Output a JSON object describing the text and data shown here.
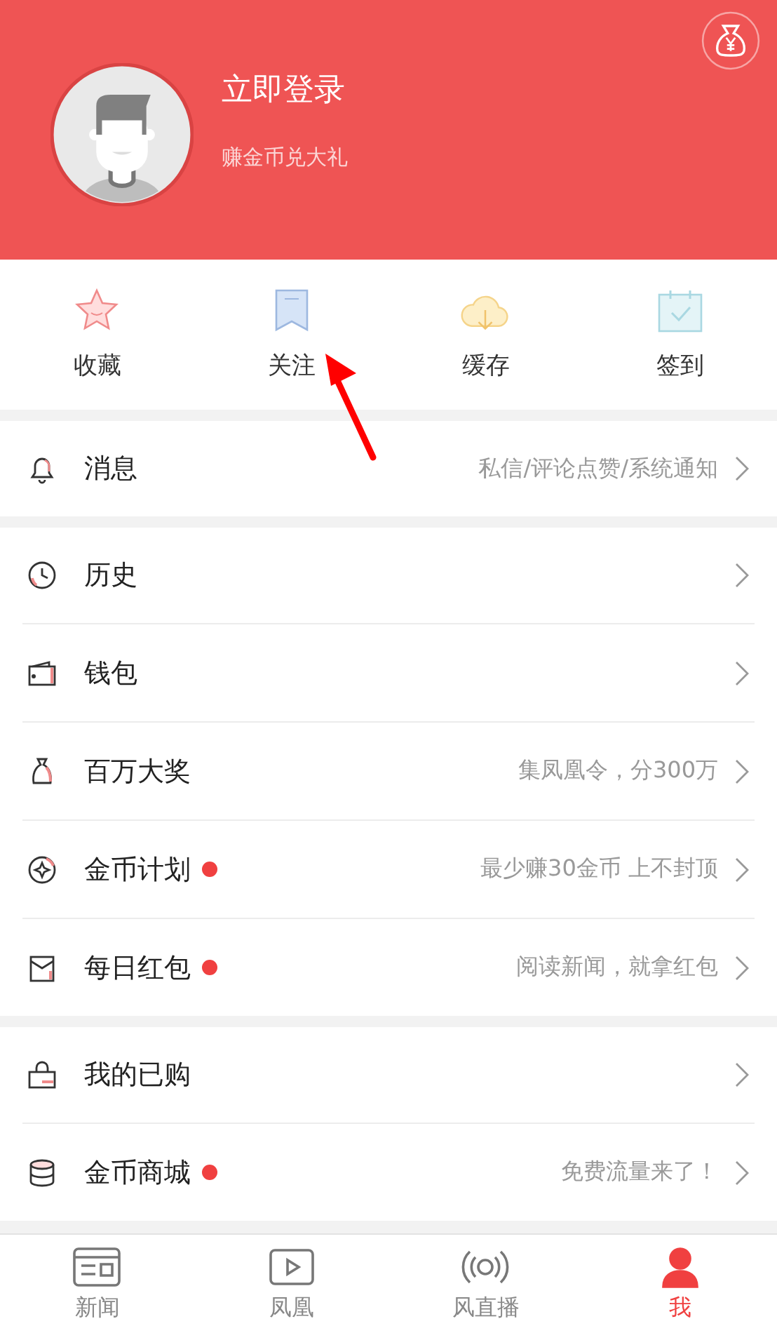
{
  "header": {
    "title": "立即登录",
    "subtitle": "赚金币兑大礼"
  },
  "shortcuts": [
    {
      "kind": "star",
      "label": "收藏"
    },
    {
      "kind": "bookmark",
      "label": "关注"
    },
    {
      "kind": "cloud",
      "label": "缓存"
    },
    {
      "kind": "calendar",
      "label": "签到"
    }
  ],
  "groups": [
    [
      {
        "kind": "bell",
        "label": "消息",
        "dot": false,
        "detail": "私信/评论点赞/系统通知"
      }
    ],
    [
      {
        "kind": "clock",
        "label": "历史",
        "dot": false
      },
      {
        "kind": "wallet",
        "label": "钱包",
        "dot": false
      },
      {
        "kind": "moneybag",
        "label": "百万大奖",
        "dot": false,
        "detail": "集凤凰令，分300万"
      },
      {
        "kind": "coin",
        "label": "金币计划",
        "dot": true,
        "detail": "最少赚30金币 上不封顶"
      },
      {
        "kind": "envelope",
        "label": "每日红包",
        "dot": true,
        "detail": "阅读新闻，就拿红包"
      }
    ],
    [
      {
        "kind": "handbag",
        "label": "我的已购",
        "dot": false
      },
      {
        "kind": "coins",
        "label": "金币商城",
        "dot": true,
        "detail": "免费流量来了！"
      }
    ]
  ],
  "tabs": [
    {
      "kind": "news",
      "label": "新闻",
      "selected": false
    },
    {
      "kind": "video",
      "label": "凤凰",
      "selected": false
    },
    {
      "kind": "live",
      "label": "风直播",
      "selected": false
    },
    {
      "kind": "person",
      "label": "我",
      "selected": true
    }
  ]
}
